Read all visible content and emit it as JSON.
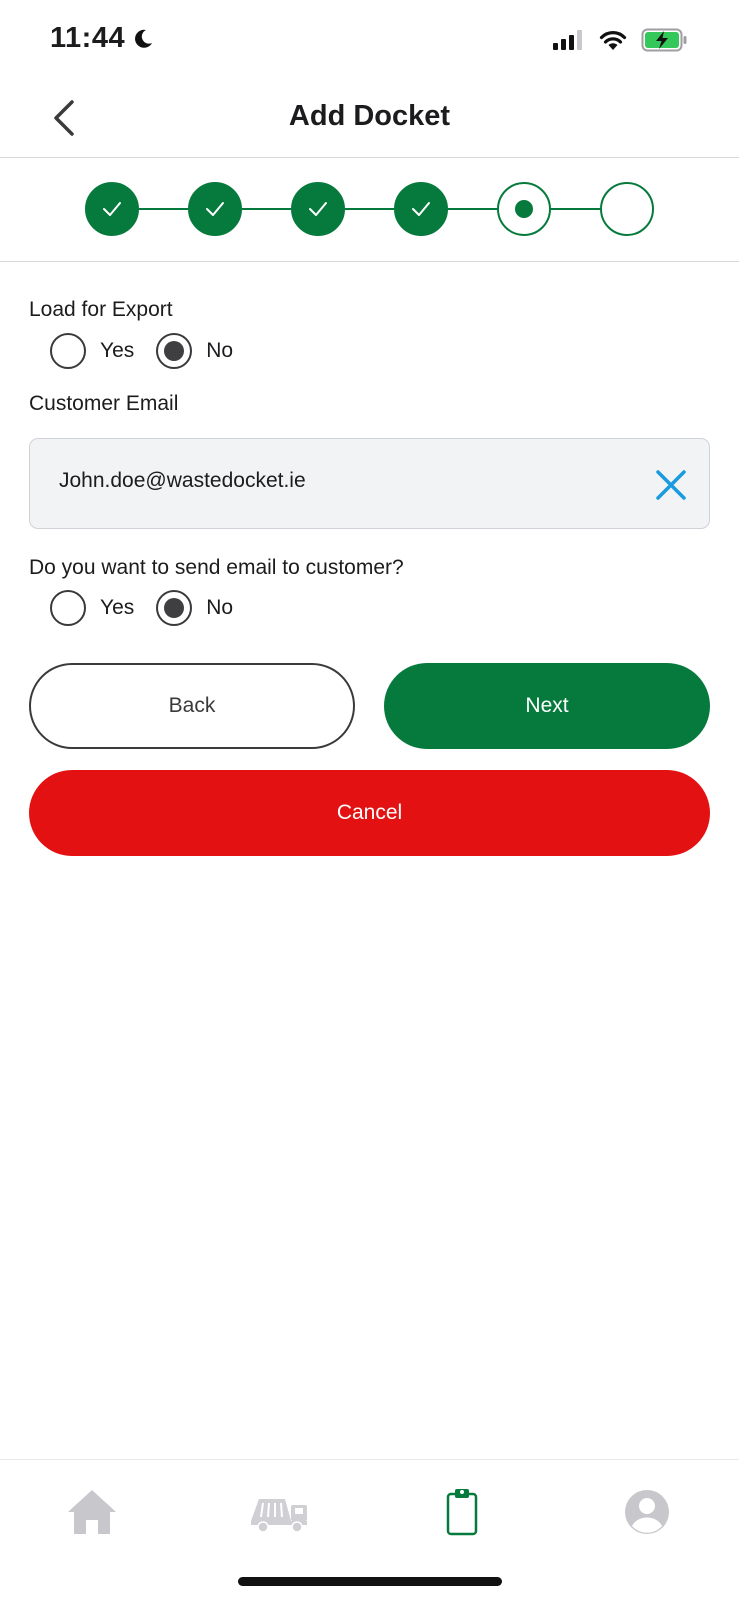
{
  "status_bar": {
    "time": "11:44",
    "icons": [
      "moon-icon",
      "signal-icon",
      "wifi-icon",
      "battery-charging-icon"
    ]
  },
  "header": {
    "title": "Add Docket",
    "back_icon": "chevron-left-icon"
  },
  "stepper": {
    "total_steps": 6,
    "completed_steps": 4,
    "current_step": 5,
    "accent_color": "#067a3c"
  },
  "form": {
    "load_for_export": {
      "label": "Load for Export",
      "options": [
        "Yes",
        "No"
      ],
      "selected": "No"
    },
    "customer_email": {
      "label": "Customer Email",
      "value": "John.doe@wastedocket.ie",
      "clear_icon": "close-icon"
    },
    "send_email": {
      "label": "Do you want to send email to customer?",
      "options": [
        "Yes",
        "No"
      ],
      "selected": "No"
    }
  },
  "buttons": {
    "back": "Back",
    "next": "Next",
    "cancel": "Cancel"
  },
  "colors": {
    "primary_green": "#067a3c",
    "cancel_red": "#e31111",
    "clear_icon_blue": "#1a9be0",
    "inactive_tab": "#c7c7cc"
  },
  "tab_bar": {
    "tabs": [
      {
        "icon": "home-icon",
        "active": false
      },
      {
        "icon": "skip-truck-icon",
        "active": false
      },
      {
        "icon": "clipboard-icon",
        "active": true
      },
      {
        "icon": "profile-icon",
        "active": false
      }
    ]
  }
}
